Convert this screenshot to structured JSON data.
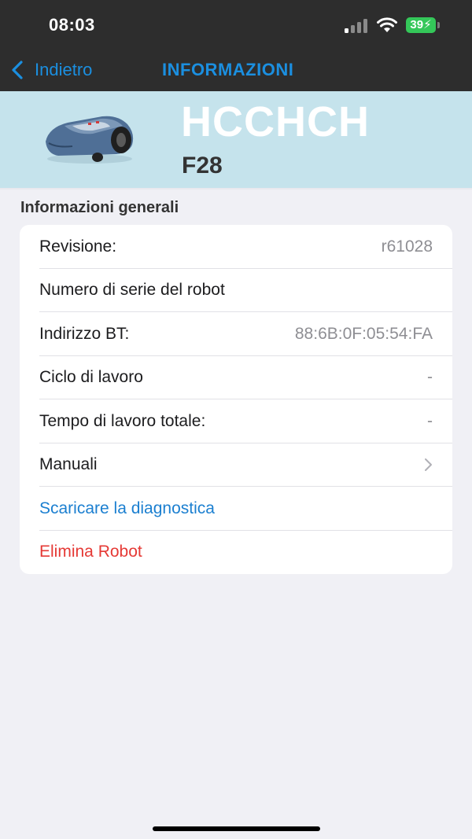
{
  "status_bar": {
    "time": "08:03",
    "battery_level": "39",
    "battery_color": "#34c759"
  },
  "nav": {
    "back_label": "Indietro",
    "title": "INFORMAZIONI",
    "accent_color": "#1b8fe0"
  },
  "robot": {
    "name": "HCCHCH",
    "model": "F28",
    "image_icon": "robot-lawnmower-icon"
  },
  "section": {
    "title": "Informazioni generali"
  },
  "rows": [
    {
      "label": "Revisione:",
      "value": "r61028"
    },
    {
      "label": "Numero di serie del robot",
      "value": ""
    },
    {
      "label": "Indirizzo BT:",
      "value": "88:6B:0F:05:54:FA"
    },
    {
      "label": "Ciclo di lavoro",
      "value": "-"
    },
    {
      "label": "Tempo di lavoro totale:",
      "value": "-"
    },
    {
      "label": "Manuali",
      "icon": "chevron-right-icon"
    }
  ],
  "actions": {
    "download_diagnostics": "Scaricare la diagnostica",
    "delete_robot": "Elimina Robot"
  }
}
